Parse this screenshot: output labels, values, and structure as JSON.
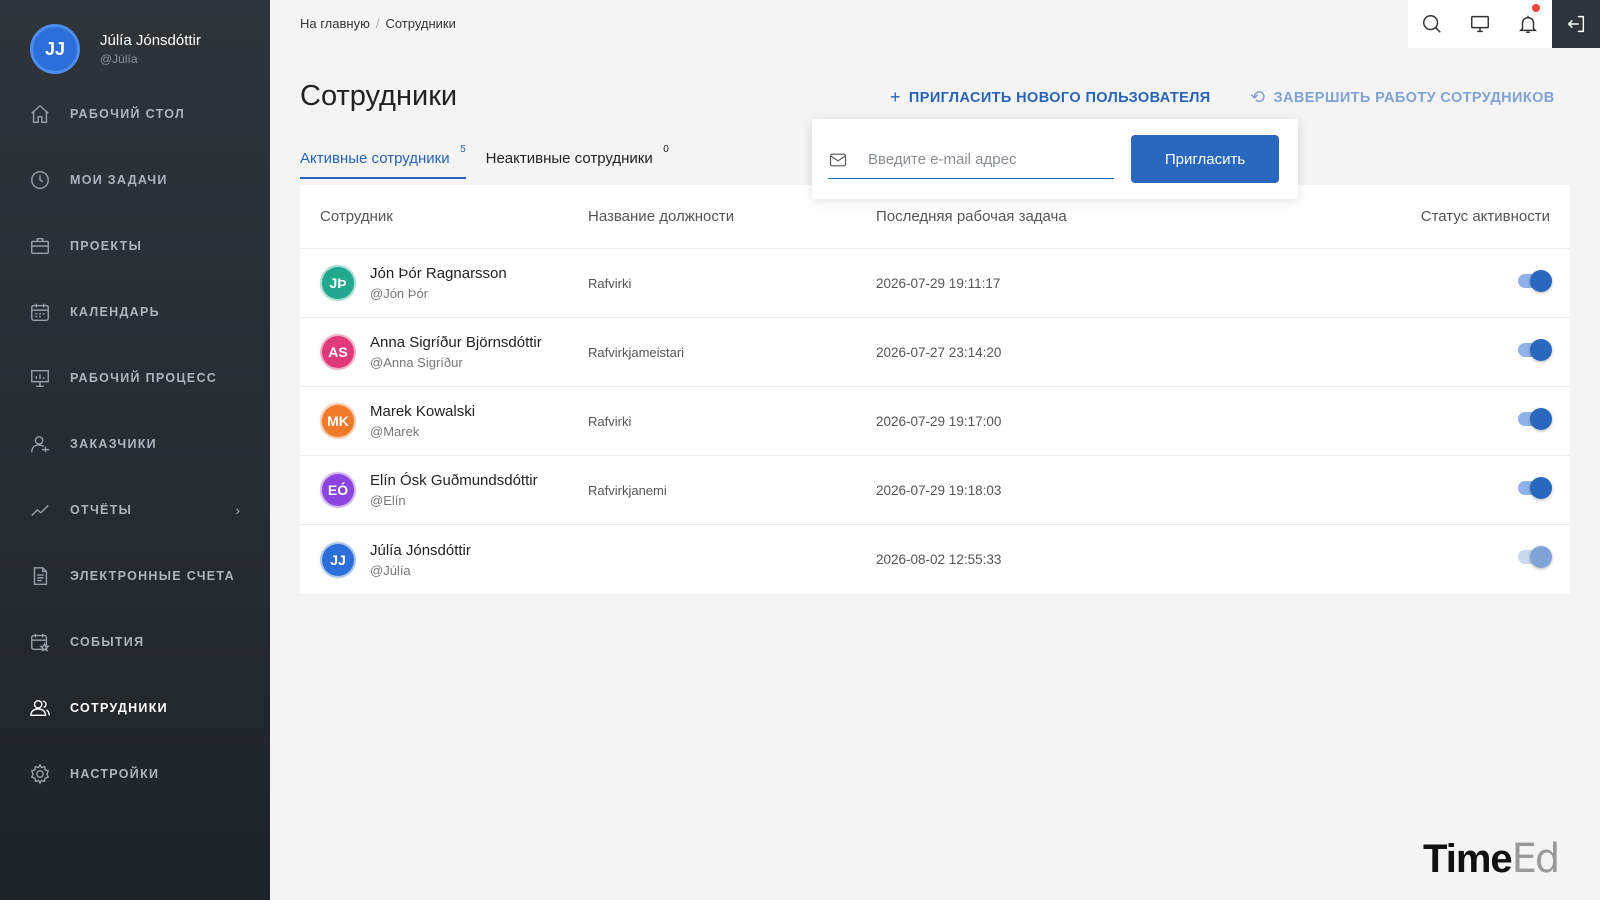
{
  "user": {
    "initials": "JJ",
    "name": "Júlía Jónsdóttir",
    "handle": "@Júlía"
  },
  "nav": [
    {
      "label": "РАБОЧИЙ СТОЛ",
      "icon": "home-icon"
    },
    {
      "label": "МОИ ЗАДАЧИ",
      "icon": "clock-icon"
    },
    {
      "label": "ПРОЕКТЫ",
      "icon": "briefcase-icon"
    },
    {
      "label": "КАЛЕНДАРЬ",
      "icon": "calendar-icon"
    },
    {
      "label": "РАБОЧИЙ ПРОЦЕСС",
      "icon": "presentation-chart-icon"
    },
    {
      "label": "ЗАКАЗЧИКИ",
      "icon": "client-icon"
    },
    {
      "label": "ОТЧЁТЫ",
      "icon": "trend-icon"
    },
    {
      "label": "ЭЛЕКТРОННЫЕ СЧЕТА",
      "icon": "invoice-icon"
    },
    {
      "label": "СОБЫТИЯ",
      "icon": "event-icon"
    },
    {
      "label": "СОТРУДНИКИ",
      "icon": "users-icon"
    },
    {
      "label": "НАСТРОЙКИ",
      "icon": "gear-icon"
    }
  ],
  "breadcrumb": {
    "home": "На главную",
    "current": "Сотрудники"
  },
  "page": {
    "title": "Сотрудники",
    "invite_action": "ПРИГЛАСИТЬ НОВОГО ПОЛЬЗОВАТЕЛЯ",
    "end_action": "ЗАВЕРШИТЬ РАБОТУ СОТРУДНИКОВ"
  },
  "tabs": {
    "active_label": "Активные сотрудники",
    "active_count": "5",
    "inactive_label": "Неактивные сотрудники",
    "inactive_count": "0"
  },
  "invite": {
    "placeholder": "Введите e-mail адрес",
    "button": "Пригласить"
  },
  "table": {
    "headers": {
      "employee": "Сотрудник",
      "job": "Название должности",
      "last_task": "Последняя рабочая задача",
      "status": "Статус активности"
    },
    "rows": [
      {
        "initials": "JÞ",
        "color": "#21a88f",
        "name": "Jón Þór Ragnarsson",
        "handle": "@Jón Þór",
        "job": "Rafvirki",
        "last_task": "2026-07-29 19:11:17",
        "active": true
      },
      {
        "initials": "AS",
        "color": "#e03a78",
        "name": "Anna Sigríður Björnsdóttir",
        "handle": "@Anna Sigríður",
        "job": "Rafvirkjameistari",
        "last_task": "2026-07-27 23:14:20",
        "active": true
      },
      {
        "initials": "MK",
        "color": "#f07a2a",
        "name": "Marek Kowalski",
        "handle": "@Marek",
        "job": "Rafvirki",
        "last_task": "2026-07-29 19:17:00",
        "active": true
      },
      {
        "initials": "EÓ",
        "color": "#8a44e0",
        "name": "Elín Ósk Guðmundsdóttir",
        "handle": "@Elín",
        "job": "Rafvirkjanemi",
        "last_task": "2026-07-29 19:18:03",
        "active": true
      },
      {
        "initials": "JJ",
        "color": "#2d6fd8",
        "name": "Júlía Jónsdóttir",
        "handle": "@Júlía",
        "job": "",
        "last_task": "2026-08-02 12:55:33",
        "active": true,
        "self": true
      }
    ]
  },
  "brand": {
    "a": "Time",
    "b": "Ed"
  }
}
